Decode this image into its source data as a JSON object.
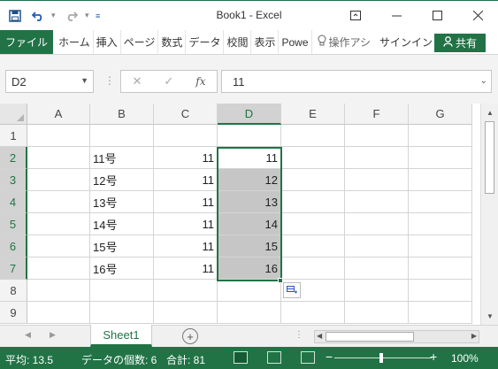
{
  "window": {
    "title": "Book1 - Excel"
  },
  "quick_access": {
    "save_icon": "save-icon",
    "undo_icon": "undo-icon",
    "redo_icon": "redo-icon"
  },
  "ribbon": {
    "file_label": "ファイル",
    "tabs": [
      "ホーム",
      "挿入",
      "ページ",
      "数式",
      "データ",
      "校閲",
      "表示",
      "Powe"
    ],
    "tell_me": "操作アシ",
    "sign_in": "サインイン",
    "share": "共有"
  },
  "formula_bar": {
    "name_box": "D2",
    "fx": "fx",
    "value": "11"
  },
  "grid": {
    "columns": [
      "A",
      "B",
      "C",
      "D",
      "E",
      "F",
      "G"
    ],
    "rows": [
      "1",
      "2",
      "3",
      "4",
      "5",
      "6",
      "7",
      "8",
      "9"
    ],
    "data": [
      {
        "row": 2,
        "B": "11号",
        "C": "11",
        "D": "11"
      },
      {
        "row": 3,
        "B": "12号",
        "C": "11",
        "D": "12"
      },
      {
        "row": 4,
        "B": "13号",
        "C": "11",
        "D": "13"
      },
      {
        "row": 5,
        "B": "14号",
        "C": "11",
        "D": "14"
      },
      {
        "row": 6,
        "B": "15号",
        "C": "11",
        "D": "15"
      },
      {
        "row": 7,
        "B": "16号",
        "C": "11",
        "D": "16"
      }
    ]
  },
  "sheets": {
    "active": "Sheet1"
  },
  "status": {
    "average": "平均: 13.5",
    "count": "データの個数: 6",
    "sum": "合計: 81",
    "zoom": "100%"
  },
  "colors": {
    "accent": "#217346",
    "selection": "#c6c6c6"
  }
}
